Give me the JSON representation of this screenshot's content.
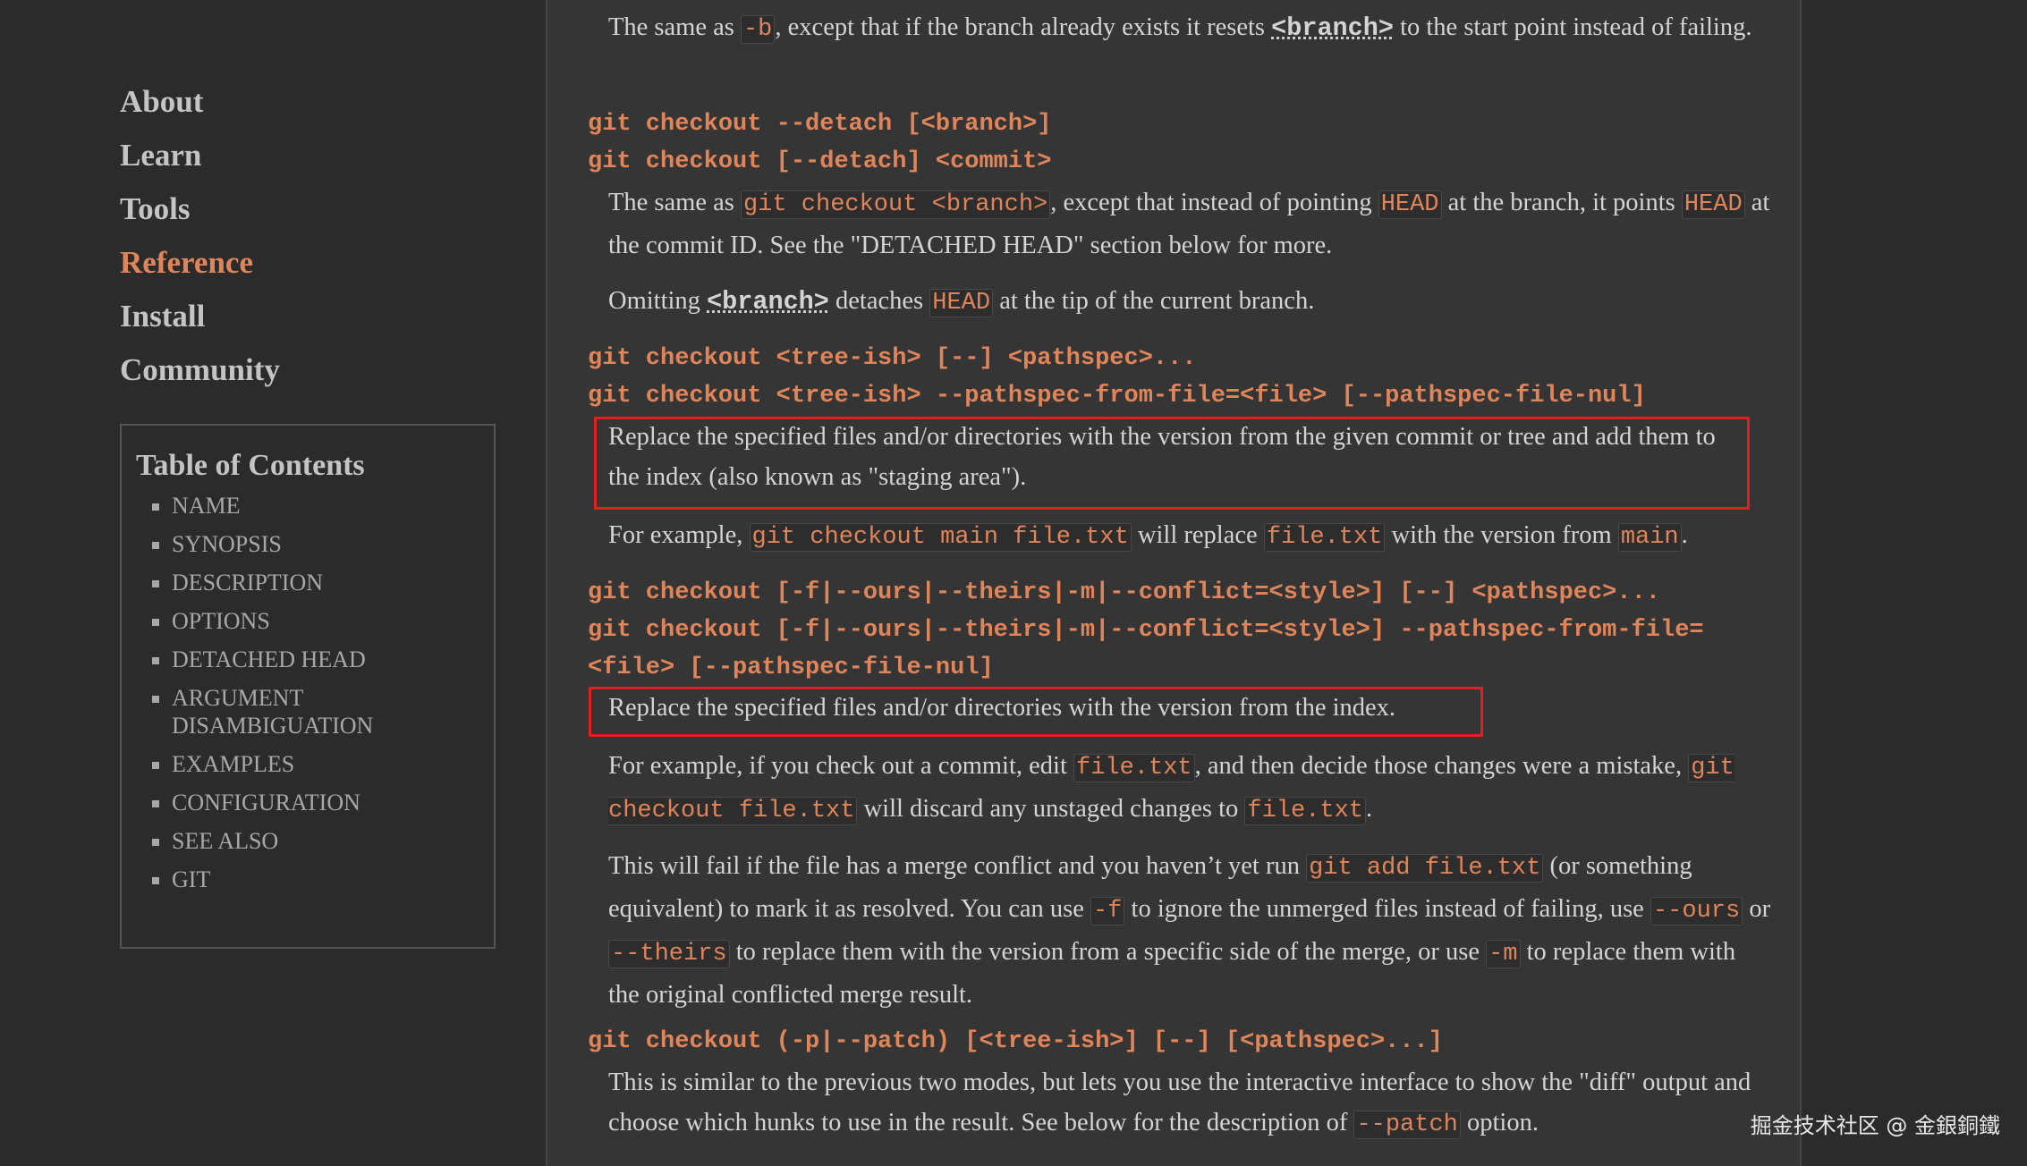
{
  "nav": {
    "items": [
      "About",
      "Learn",
      "Tools",
      "Reference",
      "Install",
      "Community"
    ],
    "active": "Reference"
  },
  "toc": {
    "title": "Table of Contents",
    "items": [
      "NAME",
      "SYNOPSIS",
      "DESCRIPTION",
      "OPTIONS",
      "DETACHED HEAD",
      "ARGUMENT DISAMBIGUATION",
      "EXAMPLES",
      "CONFIGURATION",
      "SEE ALSO",
      "GIT"
    ]
  },
  "content": {
    "p0_a": "The same as ",
    "p0_code": "-b",
    "p0_b": ", except that if the branch already exists it resets ",
    "p0_ref": "<branch>",
    "p0_c": " to the start point instead of failing.",
    "cmd1": "git checkout --detach [<branch>]",
    "cmd2": "git checkout [--detach] <commit>",
    "p1_a": "The same as ",
    "p1_code1": "git checkout <branch>",
    "p1_b": ", except that instead of pointing ",
    "p1_code2": "HEAD",
    "p1_c": " at the branch, it points ",
    "p1_code3": "HEAD",
    "p1_d": " at the commit ID. See the \"DETACHED HEAD\" section below for more.",
    "p2_a": "Omitting ",
    "p2_ref": "<branch>",
    "p2_b": " detaches ",
    "p2_code": "HEAD",
    "p2_c": " at the tip of the current branch.",
    "cmd3": "git checkout <tree-ish> [--] <pathspec>...",
    "cmd4": "git checkout <tree-ish> --pathspec-from-file=<file> [--pathspec-file-nul]",
    "p3": "Replace the specified files and/or directories with the version from the given commit or tree and add them to the index (also known as \"staging area\").",
    "p4_a": "For example, ",
    "p4_code1": "git checkout main file.txt",
    "p4_b": " will replace ",
    "p4_code2": "file.txt",
    "p4_c": " with the version from ",
    "p4_code3": "main",
    "p4_d": ".",
    "cmd5": "git checkout [-f|--ours|--theirs|-m|--conflict=<style>] [--] <pathspec>...",
    "cmd6a": "git checkout [-f|--ours|--theirs|-m|--conflict=<style>] --pathspec-from-file=",
    "cmd6b": "<file> [--pathspec-file-nul]",
    "p5": "Replace the specified files and/or directories with the version from the index.",
    "p6_a": "For example, if you check out a commit, edit ",
    "p6_code1": "file.txt",
    "p6_b": ", and then decide those changes were a mistake, ",
    "p6_code2": "git checkout file.txt",
    "p6_c": " will discard any unstaged changes to ",
    "p6_code3": "file.txt",
    "p6_d": ".",
    "p7_a": "This will fail if the file has a merge conflict and you haven’t yet run ",
    "p7_code1": "git add file.txt",
    "p7_b": " (or something equivalent) to mark it as resolved. You can use ",
    "p7_code2": "-f",
    "p7_c": " to ignore the unmerged files instead of failing, use ",
    "p7_code3": "--ours",
    "p7_d": " or ",
    "p7_code4": "--theirs",
    "p7_e": " to replace them with the version from a specific side of the merge, or use ",
    "p7_code5": "-m",
    "p7_f": " to replace them with the original conflicted merge result.",
    "cmd7": "git checkout (-p|--patch) [<tree-ish>] [--] [<pathspec>...]",
    "p8_a": "This is similar to the previous two modes, but lets you use the interactive interface to show the \"diff\" output and choose which hunks to use in the result. See below for the description of ",
    "p8_code": "--patch",
    "p8_b": " option."
  },
  "watermark": "掘金技术社区 @ 金銀銅鐵",
  "colors": {
    "accent": "#e0855a",
    "highlight_border": "#e02020",
    "background": "#2b2b2b",
    "content_bg": "#353535"
  }
}
